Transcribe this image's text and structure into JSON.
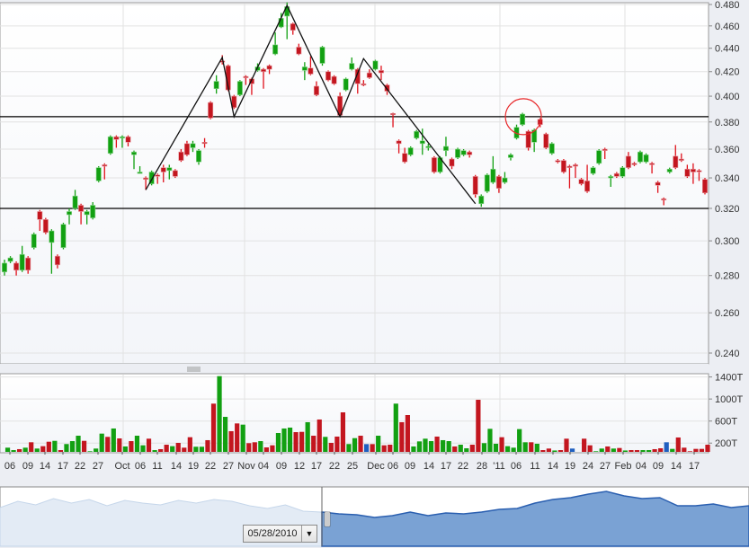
{
  "colors": {
    "up": "#12a012",
    "down": "#c3161f",
    "volume_special": "#1f5fc0",
    "navigator_fill": "#7aa2d4",
    "navigator_line": "#2a5fb0",
    "annotation_circle": "#e8282a"
  },
  "chart_data": {
    "type": "candlestick",
    "y_axis": {
      "scale": "log",
      "range": [
        0.24,
        0.48
      ],
      "ticks": [
        "0.480",
        "0.460",
        "0.440",
        "0.420",
        "0.400",
        "0.380",
        "0.360",
        "0.340",
        "0.320",
        "0.300",
        "0.280",
        "0.260",
        "0.240"
      ]
    },
    "volume_axis": {
      "range_T": [
        0,
        1400
      ],
      "ticks": [
        "1400T",
        "1000T",
        "600T",
        "200T"
      ]
    },
    "x_labels": [
      "06",
      "09",
      "14",
      "17",
      "22",
      "27",
      "Oct",
      "06",
      "11",
      "14",
      "19",
      "22",
      "27",
      "Nov",
      "04",
      "09",
      "12",
      "17",
      "22",
      "25",
      "Dec",
      "06",
      "09",
      "14",
      "17",
      "22",
      "28",
      "'11",
      "06",
      "11",
      "14",
      "19",
      "24",
      "27",
      "Feb",
      "04",
      "09",
      "14",
      "17"
    ],
    "candles_ochl": [
      [
        0.282,
        0.287,
        0.289,
        0.28
      ],
      [
        0.288,
        0.29,
        0.291,
        0.287
      ],
      [
        0.287,
        0.283,
        0.288,
        0.28
      ],
      [
        0.283,
        0.292,
        0.297,
        0.282
      ],
      [
        0.29,
        0.283,
        0.291,
        0.281
      ],
      [
        0.296,
        0.304,
        0.305,
        0.295
      ],
      [
        0.318,
        0.313,
        0.319,
        0.306
      ],
      [
        0.313,
        0.305,
        0.314,
        0.304
      ],
      [
        0.299,
        0.306,
        0.307,
        0.281
      ],
      [
        0.291,
        0.286,
        0.292,
        0.284
      ],
      [
        0.296,
        0.31,
        0.311,
        0.295
      ],
      [
        0.316,
        0.318,
        0.32,
        0.31
      ],
      [
        0.32,
        0.328,
        0.332,
        0.319
      ],
      [
        0.322,
        0.318,
        0.323,
        0.31
      ],
      [
        0.316,
        0.318,
        0.319,
        0.31
      ],
      [
        0.314,
        0.322,
        0.324,
        0.313
      ],
      [
        0.338,
        0.347,
        0.348,
        0.337
      ],
      [
        0.349,
        0.348,
        0.35,
        0.339
      ],
      [
        0.357,
        0.369,
        0.37,
        0.356
      ],
      [
        0.369,
        0.367,
        0.37,
        0.361
      ],
      [
        0.368,
        0.369,
        0.37,
        0.361
      ],
      [
        0.369,
        0.365,
        0.37,
        0.362
      ],
      [
        0.356,
        0.358,
        0.359,
        0.346
      ],
      [
        0.343,
        0.344,
        0.348,
        0.343
      ],
      [
        0.34,
        0.339,
        0.341,
        0.332
      ],
      [
        0.336,
        0.344,
        0.345,
        0.335
      ],
      [
        0.342,
        0.341,
        0.343,
        0.336
      ],
      [
        0.347,
        0.344,
        0.349,
        0.337
      ],
      [
        0.345,
        0.347,
        0.349,
        0.339
      ],
      [
        0.345,
        0.341,
        0.346,
        0.34
      ],
      [
        0.358,
        0.352,
        0.36,
        0.351
      ],
      [
        0.364,
        0.356,
        0.366,
        0.355
      ],
      [
        0.361,
        0.364,
        0.366,
        0.358
      ],
      [
        0.351,
        0.359,
        0.36,
        0.349
      ],
      [
        0.365,
        0.364,
        0.368,
        0.361
      ],
      [
        0.395,
        0.383,
        0.396,
        0.382
      ],
      [
        0.406,
        0.412,
        0.417,
        0.402
      ],
      [
        0.429,
        0.428,
        0.434,
        0.426
      ],
      [
        0.425,
        0.405,
        0.426,
        0.404
      ],
      [
        0.4,
        0.391,
        0.401,
        0.39
      ],
      [
        0.401,
        0.412,
        0.413,
        0.4
      ],
      [
        0.416,
        0.415,
        0.417,
        0.409
      ],
      [
        0.414,
        0.41,
        0.415,
        0.401
      ],
      [
        0.421,
        0.424,
        0.427,
        0.42
      ],
      [
        0.422,
        0.42,
        0.423,
        0.406
      ],
      [
        0.425,
        0.422,
        0.426,
        0.418
      ],
      [
        0.435,
        0.443,
        0.454,
        0.434
      ],
      [
        0.459,
        0.467,
        0.472,
        0.458
      ],
      [
        0.469,
        0.478,
        0.482,
        0.448
      ],
      [
        0.462,
        0.456,
        0.463,
        0.452
      ],
      [
        0.441,
        0.435,
        0.444,
        0.434
      ],
      [
        0.421,
        0.424,
        0.428,
        0.413
      ],
      [
        0.423,
        0.418,
        0.433,
        0.417
      ],
      [
        0.408,
        0.401,
        0.412,
        0.4
      ],
      [
        0.427,
        0.441,
        0.442,
        0.425
      ],
      [
        0.42,
        0.413,
        0.421,
        0.412
      ],
      [
        0.416,
        0.41,
        0.417,
        0.409
      ],
      [
        0.4,
        0.385,
        0.403,
        0.384
      ],
      [
        0.405,
        0.414,
        0.415,
        0.404
      ],
      [
        0.422,
        0.427,
        0.432,
        0.421
      ],
      [
        0.422,
        0.41,
        0.423,
        0.402
      ],
      [
        0.41,
        0.409,
        0.413,
        0.408
      ],
      [
        0.419,
        0.415,
        0.422,
        0.414
      ],
      [
        0.422,
        0.429,
        0.43,
        0.421
      ],
      [
        0.421,
        0.419,
        0.425,
        0.413
      ],
      [
        0.409,
        0.404,
        0.41,
        0.401
      ],
      [
        0.3865,
        0.386,
        0.387,
        0.376
      ],
      [
        0.366,
        0.364,
        0.367,
        0.357
      ],
      [
        0.357,
        0.351,
        0.361,
        0.35
      ],
      [
        0.356,
        0.361,
        0.362,
        0.355
      ],
      [
        0.368,
        0.373,
        0.374,
        0.367
      ],
      [
        0.364,
        0.366,
        0.375,
        0.356
      ],
      [
        0.361,
        0.362,
        0.364,
        0.359
      ],
      [
        0.354,
        0.344,
        0.355,
        0.343
      ],
      [
        0.344,
        0.354,
        0.355,
        0.343
      ],
      [
        0.359,
        0.362,
        0.369,
        0.355
      ],
      [
        0.353,
        0.348,
        0.354,
        0.346
      ],
      [
        0.354,
        0.36,
        0.361,
        0.353
      ],
      [
        0.356,
        0.359,
        0.36,
        0.355
      ],
      [
        0.358,
        0.356,
        0.359,
        0.354
      ],
      [
        0.341,
        0.329,
        0.342,
        0.327
      ],
      [
        0.323,
        0.328,
        0.329,
        0.321
      ],
      [
        0.331,
        0.342,
        0.343,
        0.33
      ],
      [
        0.337,
        0.346,
        0.355,
        0.336
      ],
      [
        0.341,
        0.333,
        0.342,
        0.33
      ],
      [
        0.337,
        0.34,
        0.344,
        0.336
      ],
      [
        0.354,
        0.356,
        0.357,
        0.352
      ],
      [
        0.368,
        0.376,
        0.378,
        0.367
      ],
      [
        0.378,
        0.386,
        0.387,
        0.377
      ],
      [
        0.373,
        0.361,
        0.374,
        0.359
      ],
      [
        0.365,
        0.374,
        0.375,
        0.358
      ],
      [
        0.382,
        0.378,
        0.383,
        0.376
      ],
      [
        0.371,
        0.361,
        0.372,
        0.36
      ],
      [
        0.357,
        0.364,
        0.365,
        0.356
      ],
      [
        0.352,
        0.351,
        0.353,
        0.35
      ],
      [
        0.352,
        0.344,
        0.353,
        0.343
      ],
      [
        0.348,
        0.347,
        0.349,
        0.333
      ],
      [
        0.349,
        0.348,
        0.35,
        0.34
      ],
      [
        0.339,
        0.336,
        0.34,
        0.335
      ],
      [
        0.338,
        0.331,
        0.349,
        0.33
      ],
      [
        0.343,
        0.347,
        0.348,
        0.342
      ],
      [
        0.35,
        0.359,
        0.36,
        0.349
      ],
      [
        0.36,
        0.359,
        0.361,
        0.353
      ],
      [
        0.34,
        0.341,
        0.342,
        0.334
      ],
      [
        0.343,
        0.341,
        0.344,
        0.34
      ],
      [
        0.341,
        0.347,
        0.348,
        0.34
      ],
      [
        0.355,
        0.347,
        0.358,
        0.346
      ],
      [
        0.35,
        0.349,
        0.351,
        0.348
      ],
      [
        0.351,
        0.358,
        0.359,
        0.35
      ],
      [
        0.351,
        0.356,
        0.357,
        0.35
      ],
      [
        0.35,
        0.349,
        0.351,
        0.343
      ],
      [
        0.337,
        0.335,
        0.338,
        0.33
      ],
      [
        0.3262,
        0.326,
        0.327,
        0.322
      ],
      [
        0.344,
        0.346,
        0.347,
        0.343
      ],
      [
        0.355,
        0.347,
        0.363,
        0.346
      ],
      [
        0.353,
        0.352,
        0.357,
        0.351
      ],
      [
        0.346,
        0.341,
        0.349,
        0.34
      ],
      [
        0.346,
        0.344,
        0.35,
        0.336
      ],
      [
        0.345,
        0.3448,
        0.346,
        0.338
      ],
      [
        0.339,
        0.33,
        0.34,
        0.329
      ]
    ],
    "volume_T": [
      [
        36,
        "g"
      ],
      [
        117,
        "g"
      ],
      [
        73,
        "g"
      ],
      [
        90,
        "r"
      ],
      [
        117,
        "g"
      ],
      [
        215,
        "r"
      ],
      [
        101,
        "g"
      ],
      [
        144,
        "r"
      ],
      [
        225,
        "r"
      ],
      [
        241,
        "g"
      ],
      [
        73,
        "r"
      ],
      [
        183,
        "g"
      ],
      [
        236,
        "g"
      ],
      [
        334,
        "g"
      ],
      [
        241,
        "r"
      ],
      [
        52,
        "g"
      ],
      [
        101,
        "g"
      ],
      [
        372,
        "g"
      ],
      [
        313,
        "r"
      ],
      [
        465,
        "g"
      ],
      [
        285,
        "r"
      ],
      [
        139,
        "g"
      ],
      [
        236,
        "r"
      ],
      [
        334,
        "g"
      ],
      [
        160,
        "g"
      ],
      [
        280,
        "r"
      ],
      [
        73,
        "g"
      ],
      [
        90,
        "r"
      ],
      [
        171,
        "r"
      ],
      [
        144,
        "g"
      ],
      [
        204,
        "r"
      ],
      [
        117,
        "r"
      ],
      [
        307,
        "r"
      ],
      [
        134,
        "g"
      ],
      [
        134,
        "g"
      ],
      [
        253,
        "r"
      ],
      [
        916,
        "r"
      ],
      [
        1415,
        "g"
      ],
      [
        676,
        "g"
      ],
      [
        416,
        "r"
      ],
      [
        557,
        "r"
      ],
      [
        535,
        "g"
      ],
      [
        199,
        "r"
      ],
      [
        215,
        "r"
      ],
      [
        236,
        "g"
      ],
      [
        122,
        "r"
      ],
      [
        160,
        "r"
      ],
      [
        383,
        "g"
      ],
      [
        465,
        "g"
      ],
      [
        481,
        "g"
      ],
      [
        399,
        "r"
      ],
      [
        404,
        "r"
      ],
      [
        579,
        "g"
      ],
      [
        334,
        "r"
      ],
      [
        628,
        "r"
      ],
      [
        313,
        "g"
      ],
      [
        204,
        "r"
      ],
      [
        318,
        "r"
      ],
      [
        758,
        "r"
      ],
      [
        183,
        "g"
      ],
      [
        290,
        "g"
      ],
      [
        334,
        "r"
      ],
      [
        182,
        "b"
      ],
      [
        182,
        "r"
      ],
      [
        334,
        "g"
      ],
      [
        160,
        "r"
      ],
      [
        171,
        "r"
      ],
      [
        916,
        "g"
      ],
      [
        579,
        "r"
      ],
      [
        709,
        "r"
      ],
      [
        139,
        "g"
      ],
      [
        231,
        "g"
      ],
      [
        280,
        "g"
      ],
      [
        236,
        "g"
      ],
      [
        318,
        "r"
      ],
      [
        253,
        "g"
      ],
      [
        236,
        "g"
      ],
      [
        139,
        "r"
      ],
      [
        171,
        "g"
      ],
      [
        106,
        "g"
      ],
      [
        171,
        "r"
      ],
      [
        986,
        "r"
      ],
      [
        199,
        "g"
      ],
      [
        459,
        "g"
      ],
      [
        188,
        "g"
      ],
      [
        307,
        "r"
      ],
      [
        144,
        "g"
      ],
      [
        117,
        "g"
      ],
      [
        454,
        "g"
      ],
      [
        215,
        "g"
      ],
      [
        215,
        "r"
      ],
      [
        188,
        "g"
      ],
      [
        73,
        "r"
      ],
      [
        101,
        "r"
      ],
      [
        66,
        "g"
      ],
      [
        73,
        "r"
      ],
      [
        280,
        "r"
      ],
      [
        101,
        "b"
      ],
      [
        36,
        "b"
      ],
      [
        280,
        "r"
      ],
      [
        160,
        "r"
      ],
      [
        52,
        "g"
      ],
      [
        101,
        "g"
      ],
      [
        139,
        "r"
      ],
      [
        101,
        "g"
      ],
      [
        111,
        "r"
      ],
      [
        66,
        "g"
      ],
      [
        73,
        "r"
      ],
      [
        73,
        "r"
      ],
      [
        73,
        "g"
      ],
      [
        73,
        "g"
      ],
      [
        90,
        "r"
      ],
      [
        106,
        "r"
      ],
      [
        215,
        "b"
      ],
      [
        95,
        "g"
      ],
      [
        302,
        "r"
      ],
      [
        117,
        "r"
      ],
      [
        52,
        "r"
      ],
      [
        95,
        "r"
      ],
      [
        95,
        "r"
      ],
      [
        171,
        "r"
      ]
    ],
    "horizontal_lines": [
      0.384,
      0.32
    ],
    "pattern_line": [
      [
        24,
        0.332
      ],
      [
        37,
        0.432
      ],
      [
        39,
        0.384
      ],
      [
        48,
        0.479
      ],
      [
        57,
        0.384
      ],
      [
        61,
        0.431
      ],
      [
        80,
        0.323
      ]
    ],
    "annotation_circle": {
      "candle_index": 88,
      "price": 0.384
    },
    "navigator_series": [
      45,
      52,
      48,
      55,
      50,
      54,
      47,
      53,
      50,
      48,
      53,
      50,
      54,
      52,
      47,
      44,
      48,
      41,
      40,
      38,
      37,
      34,
      36,
      40,
      36,
      39,
      38,
      40,
      43,
      44,
      50,
      54,
      56,
      60,
      63,
      58,
      55,
      56,
      47,
      47,
      49,
      45,
      47
    ]
  },
  "navigator": {
    "start_date": "05/28/2010",
    "dropdown_icon": "triangle-down-icon"
  }
}
